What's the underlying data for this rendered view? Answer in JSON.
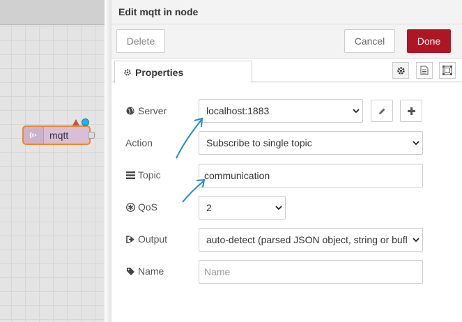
{
  "workspace": {
    "node": {
      "label": "mqtt"
    }
  },
  "tray": {
    "title": "Edit mqtt in node",
    "toolbar": {
      "delete_label": "Delete",
      "cancel_label": "Cancel",
      "done_label": "Done"
    },
    "tabs": {
      "properties_label": "Properties"
    },
    "form": {
      "server": {
        "label": "Server",
        "value": "localhost:1883"
      },
      "action": {
        "label": "Action",
        "value": "Subscribe to single topic"
      },
      "topic": {
        "label": "Topic",
        "value": "communication"
      },
      "qos": {
        "label": "QoS",
        "value": "2"
      },
      "output": {
        "label": "Output",
        "value": "auto-detect (parsed JSON object, string or bufl"
      },
      "name": {
        "label": "Name",
        "value": "",
        "placeholder": "Name"
      }
    }
  },
  "colors": {
    "done_button": "#ad1625",
    "node_fill": "#d8bfd8",
    "node_border": "#f0862e",
    "annotation_arrow": "#1f8ad6"
  },
  "icons": [
    "wifi-icon",
    "warning-triangle-icon",
    "status-dot-icon",
    "gear-icon",
    "document-icon",
    "frame-icon",
    "globe-icon",
    "list-icon",
    "asterisk-icon",
    "sign-out-icon",
    "tag-icon",
    "pencil-icon",
    "plus-icon",
    "chevron-down-icon"
  ]
}
